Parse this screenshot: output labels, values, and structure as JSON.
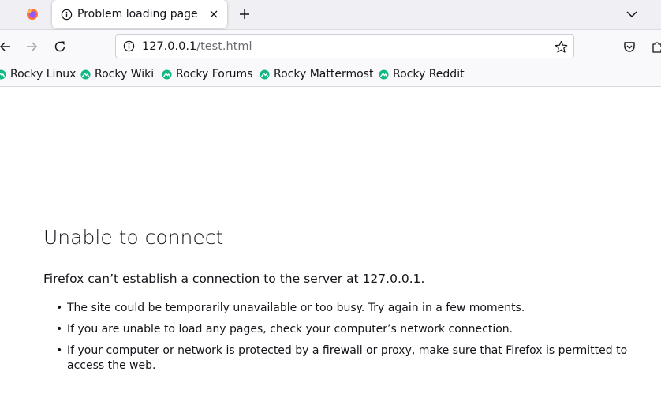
{
  "tab": {
    "title": "Problem loading page"
  },
  "urlbar": {
    "host": "127.0.0.1",
    "path": "/test.html"
  },
  "bookmarks": [
    {
      "label": "Rocky Linux"
    },
    {
      "label": "Rocky Wiki"
    },
    {
      "label": "Rocky Forums"
    },
    {
      "label": "Rocky Mattermost"
    },
    {
      "label": "Rocky Reddit"
    }
  ],
  "error": {
    "title": "Unable to connect",
    "description": "Firefox can’t establish a connection to the server at 127.0.0.1.",
    "suggestions": [
      "The site could be temporarily unavailable or too busy. Try again in a few moments.",
      "If you are unable to load any pages, check your computer’s network connection.",
      "If your computer or network is protected by a firewall or proxy, make sure that Firefox is permitted to access the web."
    ]
  },
  "icons": {
    "browser": "firefox-icon",
    "tab": "info-icon",
    "bookmark": "rocky-linux-icon"
  },
  "colors": {
    "tabstrip": "#f0f0f4",
    "toolbar": "#f9f9fb",
    "rocky_green": "#10b981",
    "text": "#15141a"
  }
}
